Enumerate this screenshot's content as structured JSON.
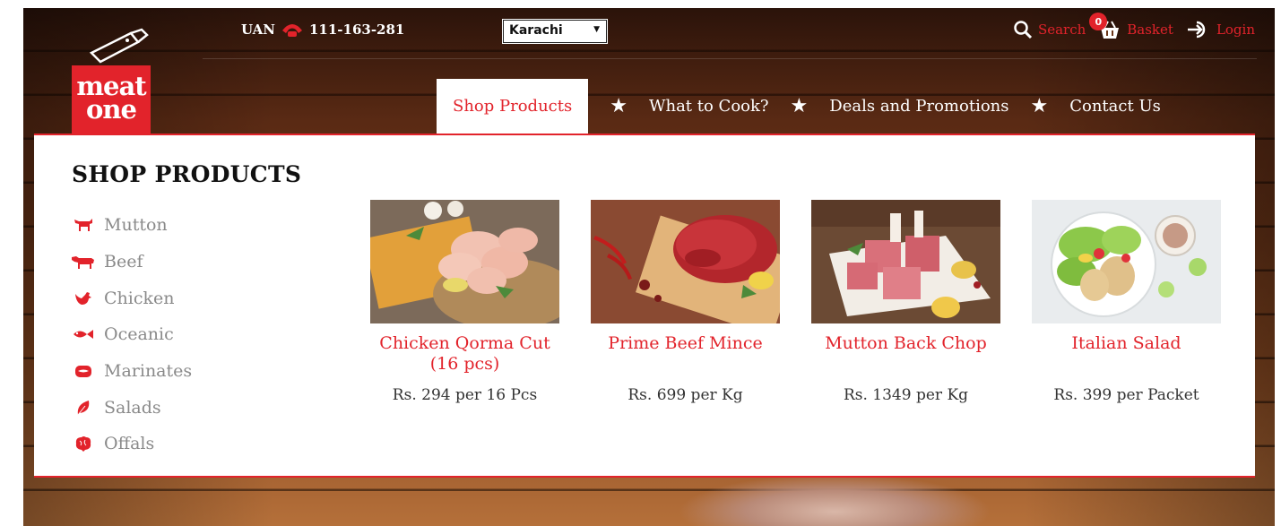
{
  "header": {
    "uan_label": "UAN",
    "uan_number": "111-163-281",
    "city": "Karachi",
    "search_label": "Search",
    "basket_label": "Basket",
    "basket_count": "0",
    "login_label": "Login"
  },
  "logo": {
    "line1": "meat",
    "line2": "one"
  },
  "nav": {
    "items": [
      {
        "label": "Shop Products"
      },
      {
        "label": "What to Cook?"
      },
      {
        "label": "Deals and Promotions"
      },
      {
        "label": "Contact Us"
      }
    ],
    "separator": "★"
  },
  "panel": {
    "title": "SHOP PRODUCTS",
    "categories": [
      {
        "label": "Mutton",
        "icon": "goat-icon"
      },
      {
        "label": "Beef",
        "icon": "cow-icon"
      },
      {
        "label": "Chicken",
        "icon": "chicken-icon"
      },
      {
        "label": "Oceanic",
        "icon": "fish-icon"
      },
      {
        "label": "Marinates",
        "icon": "marinate-icon"
      },
      {
        "label": "Salads",
        "icon": "leaf-icon"
      },
      {
        "label": "Offals",
        "icon": "brain-icon"
      }
    ],
    "products": [
      {
        "name": "Chicken Qorma Cut (16 pcs)",
        "price": "Rs. 294 per 16 Pcs"
      },
      {
        "name": "Prime Beef Mince",
        "price": "Rs. 699 per Kg"
      },
      {
        "name": "Mutton Back Chop",
        "price": "Rs. 1349 per Kg"
      },
      {
        "name": "Italian Salad",
        "price": "Rs. 399 per Packet"
      }
    ]
  },
  "colors": {
    "accent": "#e2232b",
    "panel_bg": "#ffffff",
    "category_text": "#8a8a8a"
  }
}
